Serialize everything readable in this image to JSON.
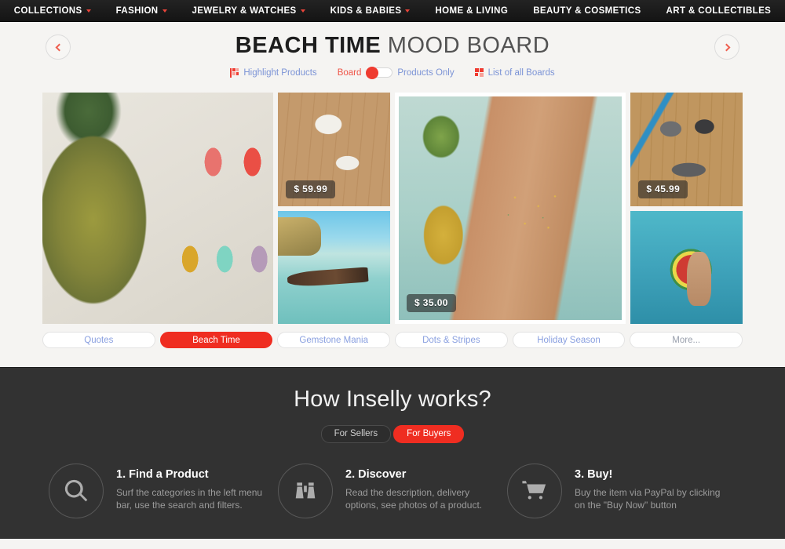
{
  "topnav": {
    "items": [
      {
        "label": "COLLECTIONS",
        "has_caret": true
      },
      {
        "label": "FASHION",
        "has_caret": true
      },
      {
        "label": "JEWELRY & WATCHES",
        "has_caret": true
      },
      {
        "label": "KIDS & BABIES",
        "has_caret": true
      },
      {
        "label": "HOME & LIVING",
        "has_caret": false
      },
      {
        "label": "BEAUTY & COSMETICS",
        "has_caret": false
      },
      {
        "label": "ART & COLLECTIBLES",
        "has_caret": false
      }
    ]
  },
  "board": {
    "title_strong": "BEACH TIME",
    "title_light": "MOOD BOARD",
    "prev_arrow": "prev-board",
    "next_arrow": "next-board",
    "controls": {
      "highlight_products": "Highlight Products",
      "toggle_left_label": "Board",
      "toggle_right_label": "Products Only",
      "toggle_state": "board",
      "list_of_boards": "List of all Boards"
    },
    "tiles": [
      {
        "name": "pineapple-nail-polish",
        "price": ""
      },
      {
        "name": "floral-bikini",
        "price": "$ 59.99"
      },
      {
        "name": "longtail-boat-beach",
        "price": ""
      },
      {
        "name": "pineapple-print-bikini",
        "price": "$ 35.00"
      },
      {
        "name": "grey-blue-bikini",
        "price": "$ 45.99"
      },
      {
        "name": "watermelon-pool-float",
        "price": ""
      }
    ],
    "tabs": [
      {
        "label": "Quotes",
        "active": false,
        "muted": false
      },
      {
        "label": "Beach Time",
        "active": true,
        "muted": false
      },
      {
        "label": "Gemstone Mania",
        "active": false,
        "muted": false
      },
      {
        "label": "Dots & Stripes",
        "active": false,
        "muted": false
      },
      {
        "label": "Holiday Season",
        "active": false,
        "muted": false
      },
      {
        "label": "More...",
        "active": false,
        "muted": true
      }
    ]
  },
  "howto": {
    "title": "How Inselly works?",
    "segments": [
      {
        "label": "For Sellers",
        "active": false
      },
      {
        "label": "For Buyers",
        "active": true
      }
    ],
    "steps": [
      {
        "icon": "search-icon",
        "title": "1. Find a Product",
        "desc": "Surf the categories in the left menu bar, use the search and filters."
      },
      {
        "icon": "binoculars-icon",
        "title": "2. Discover",
        "desc": "Read the description, delivery options, see photos of a product."
      },
      {
        "icon": "shopping-cart-icon",
        "title": "3. Buy!",
        "desc": "Buy the item via PayPal by clicking on the \"Buy Now\" button"
      }
    ]
  },
  "colors": {
    "accent_red": "#ef2d21",
    "link_blue": "#8aa0e0",
    "page_bg": "#f5f4f2",
    "dark_bg": "#323232",
    "nav_bg": "#1a1a1a"
  }
}
